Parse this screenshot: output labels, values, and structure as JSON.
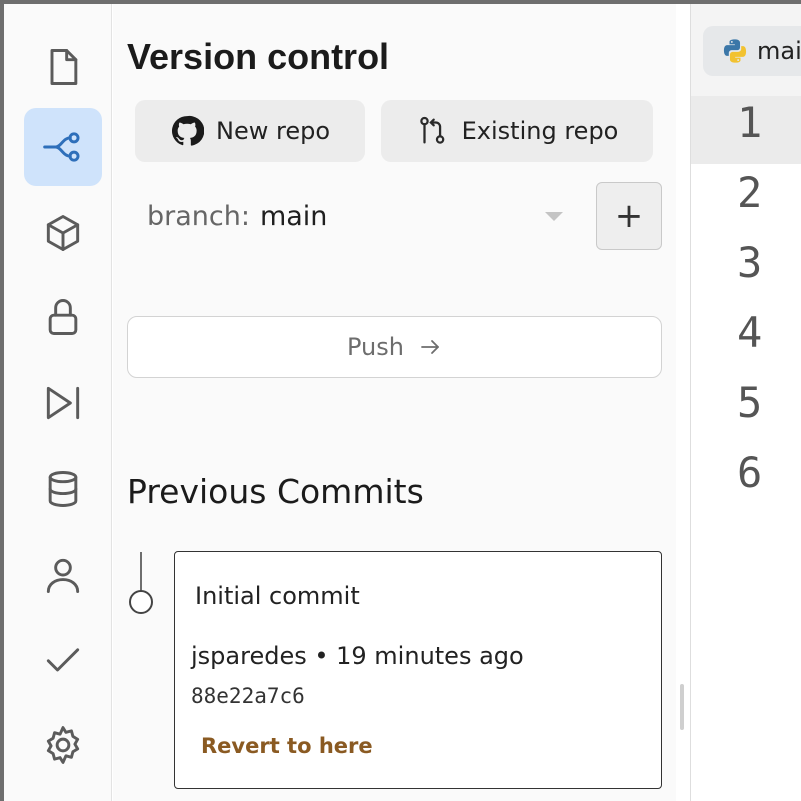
{
  "sidebar": {
    "icons": [
      {
        "name": "file-icon",
        "active": false
      },
      {
        "name": "git-branch-icon",
        "active": true
      },
      {
        "name": "package-cube-icon",
        "active": false
      },
      {
        "name": "lock-icon",
        "active": false
      },
      {
        "name": "play-skip-icon",
        "active": false
      },
      {
        "name": "database-icon",
        "active": false
      },
      {
        "name": "user-icon",
        "active": false
      },
      {
        "name": "checkmark-icon",
        "active": false
      },
      {
        "name": "settings-gear-icon",
        "active": false
      }
    ]
  },
  "panel": {
    "title": "Version control",
    "new_repo_label": "New repo",
    "existing_repo_label": "Existing repo",
    "branch_prefix": "branch:",
    "branch_value": "main",
    "add_branch_label": "+",
    "push_label": "Push",
    "previous_commits_title": "Previous Commits",
    "commits": [
      {
        "message": "Initial commit",
        "meta": "jsparedes • 19 minutes ago",
        "hash": "88e22a7c6",
        "revert_label": "Revert to here"
      }
    ]
  },
  "editor": {
    "tab_label": "main",
    "line_numbers": [
      "1",
      "2",
      "3",
      "4",
      "5",
      "6"
    ],
    "active_line": 1
  },
  "colors": {
    "active_icon_bg": "#cfe3fb",
    "revert_link": "#8a5a22",
    "panel_bg": "#fafafa"
  }
}
